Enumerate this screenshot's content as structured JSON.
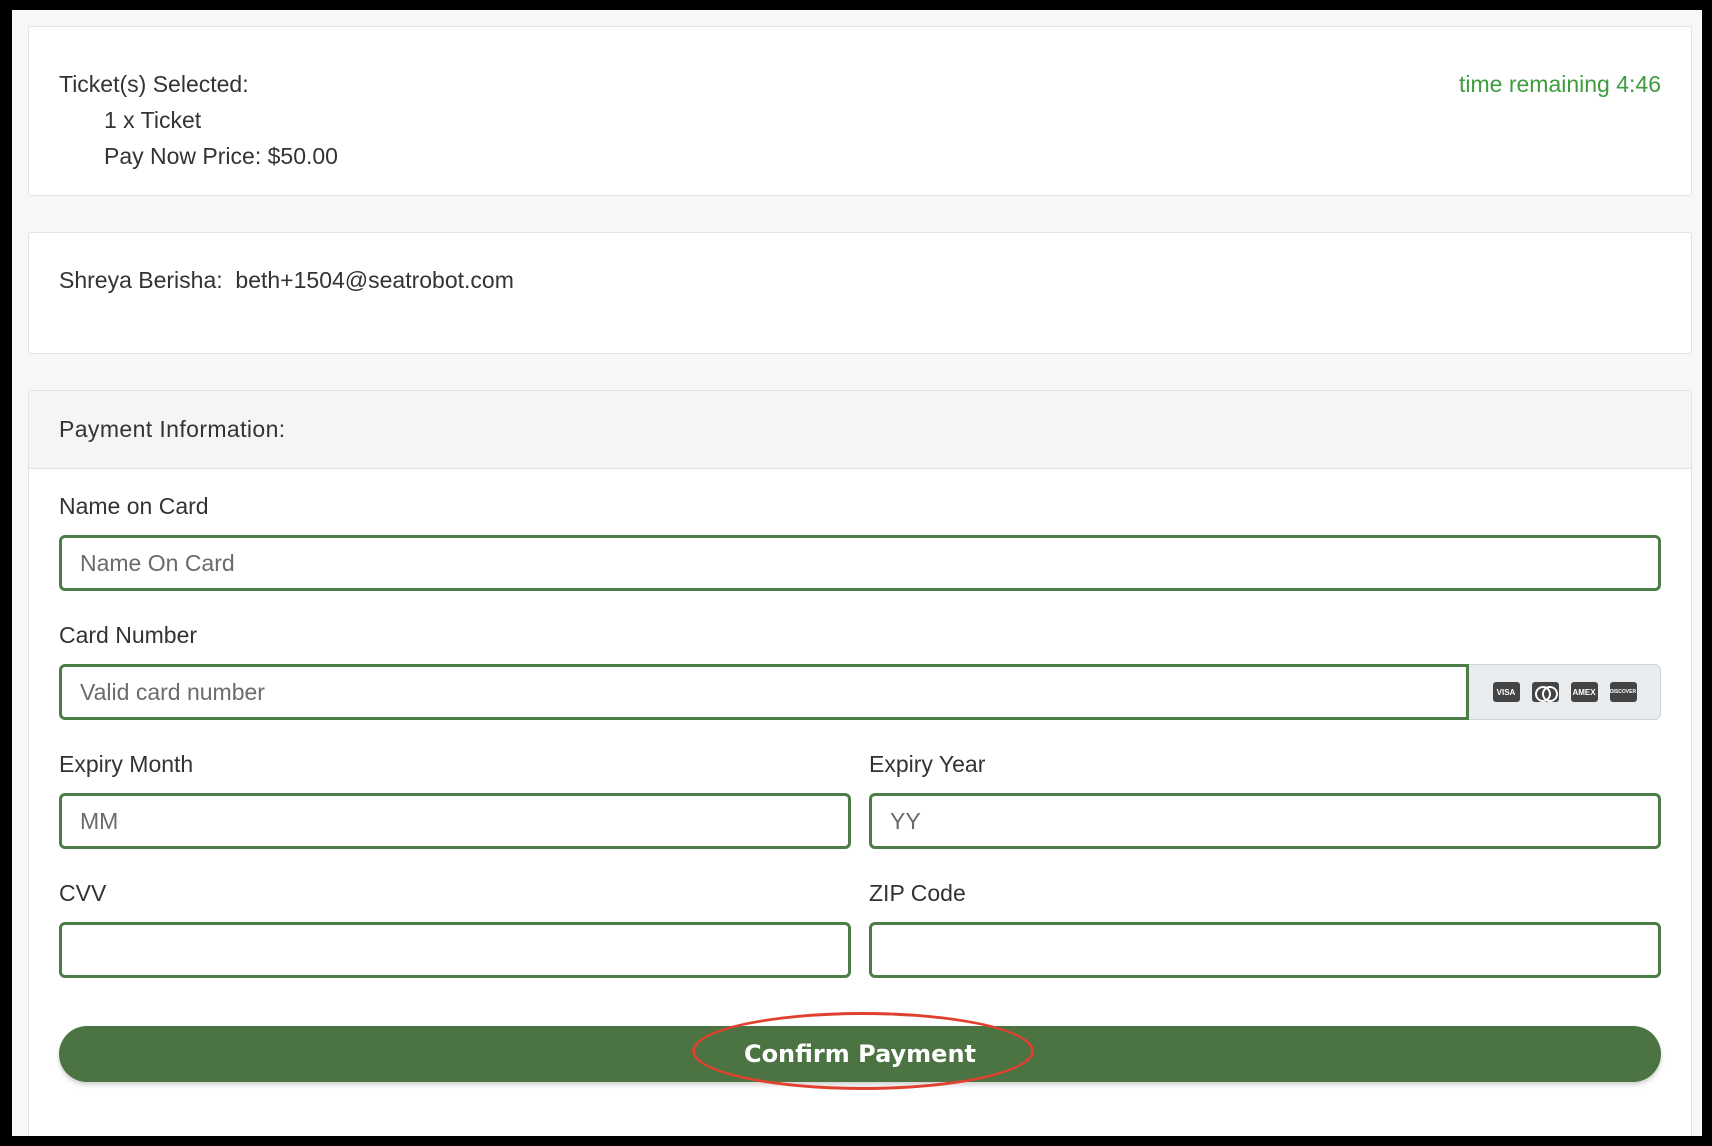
{
  "tickets": {
    "heading": "Ticket(s) Selected:",
    "item": "1 x Ticket",
    "price": "Pay Now Price: $50.00",
    "timer": "time remaining 4:46"
  },
  "contact": {
    "name": "Shreya Berisha:",
    "email": "beth+1504@seatrobot.com"
  },
  "payment": {
    "title": "Payment Information:",
    "name_label": "Name on Card",
    "name_placeholder": "Name On Card",
    "card_label": "Card Number",
    "card_placeholder": "Valid card number",
    "card_brands": [
      "VISA",
      "MC",
      "AMEX",
      "DISCOVER"
    ],
    "month_label": "Expiry Month",
    "month_placeholder": "MM",
    "year_label": "Expiry Year",
    "year_placeholder": "YY",
    "cvv_label": "CVV",
    "zip_label": "ZIP Code",
    "confirm_label": "Confirm Payment"
  },
  "colors": {
    "accent_green": "#4b7442",
    "timer_green": "#3e9b3e",
    "highlight_red": "#e0412f"
  },
  "icons": [
    "visa-icon",
    "mastercard-icon",
    "amex-icon",
    "discover-icon"
  ]
}
